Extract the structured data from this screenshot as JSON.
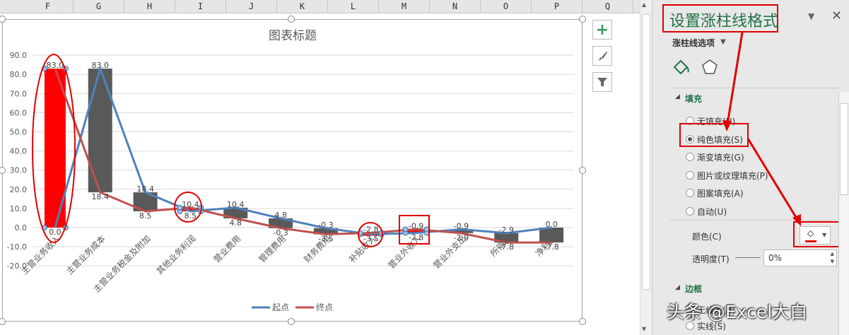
{
  "columns": [
    "F",
    "G",
    "H",
    "I",
    "J",
    "K",
    "L",
    "M",
    "N",
    "O",
    "P",
    "Q"
  ],
  "chart_data": {
    "type": "line",
    "title": "图表标题",
    "categories": [
      "主营业务收入",
      "主营业务成本",
      "主营业务税金及附加",
      "其他业务利润",
      "营业费用",
      "管理费用",
      "财务费用",
      "补贴收入",
      "营业外收入",
      "营业外支出",
      "所得税",
      "净利润"
    ],
    "series": [
      {
        "name": "起点",
        "color": "#4f81bd",
        "values": [
          0.0,
          83.0,
          18.4,
          8.5,
          10.4,
          4.8,
          -0.3,
          -3.5,
          -2.8,
          -0.9,
          -2.9,
          0.0
        ]
      },
      {
        "name": "终点",
        "color": "#c0504d",
        "values": [
          83.0,
          18.4,
          8.5,
          10.4,
          4.8,
          -0.3,
          -3.5,
          -2.8,
          -0.9,
          -2.9,
          -7.8,
          -7.8
        ]
      }
    ],
    "ylim": [
      -20,
      90
    ],
    "yticks": [
      "90.0",
      "80.0",
      "70.0",
      "60.0",
      "50.0",
      "40.0",
      "30.0",
      "20.0",
      "10.0",
      "0.0",
      "-10.0",
      "-20.0"
    ],
    "up_down_bar_color": "#595959",
    "selected_bar_color": "#ff0000",
    "grid": true,
    "legend": "bottom"
  },
  "panel": {
    "title": "设置涨柱线格式",
    "options_label": "涨柱线选项",
    "fill_section": "填充",
    "fill_options": [
      "无填充(N)",
      "纯色填充(S)",
      "渐变填充(G)",
      "图片或纹理填充(P)",
      "图案填充(A)",
      "自动(U)"
    ],
    "selected_fill": 1,
    "color_label": "颜色(C)",
    "color_value": "#ff0000",
    "transparency_label": "透明度(T)",
    "transparency_value": "0%",
    "border_section": "边框",
    "border_options": [
      "无线条(N)",
      "实线(S)"
    ]
  },
  "watermark": "头条 @Excel大白"
}
